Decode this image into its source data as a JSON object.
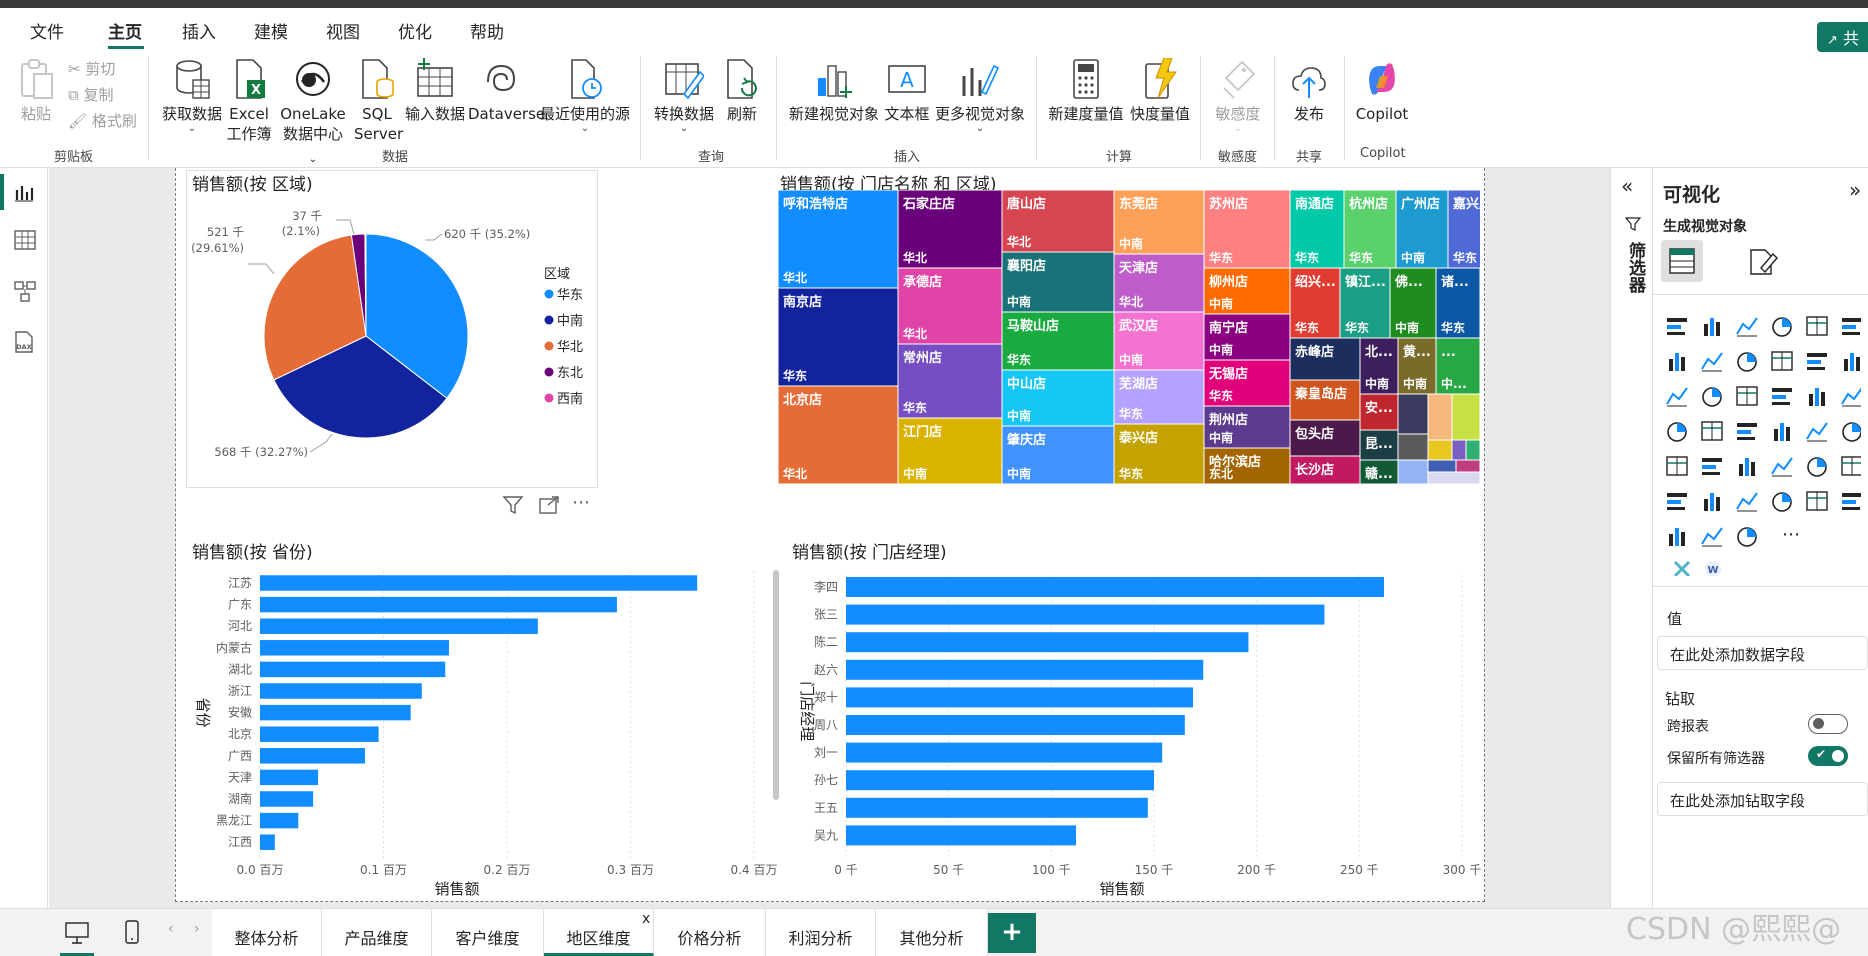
{
  "menubar": {
    "items": [
      "文件",
      "主页",
      "插入",
      "建模",
      "视图",
      "优化",
      "帮助"
    ],
    "active": "主页",
    "share_label": "共"
  },
  "ribbon": {
    "clipboard": {
      "paste": "粘贴",
      "cut": "剪切",
      "copy": "复制",
      "format_painter": "格式刷",
      "label": "剪贴板"
    },
    "data": {
      "get_data": "获取数据",
      "excel_l1": "Excel",
      "excel_l2": "工作簿",
      "onelake_l1": "OneLake",
      "onelake_l2": "数据中心",
      "sql_l1": "SQL",
      "sql_l2": "Server",
      "enter_data": "输入数据",
      "dataverse": "Dataverse",
      "recent": "最近使用的源",
      "label": "数据"
    },
    "query": {
      "transform": "转换数据",
      "refresh": "刷新",
      "label": "查询"
    },
    "insert": {
      "new_visual": "新建视觉对象",
      "textbox": "文本框",
      "more_visuals": "更多视觉对象",
      "label": "插入"
    },
    "calc": {
      "new_measure": "新建度量值",
      "quick_measure": "快度量值",
      "label": "计算"
    },
    "sensitivity": {
      "btn": "敏感度",
      "label": "敏感度"
    },
    "share": {
      "publish": "发布",
      "label": "共享"
    },
    "copilot": {
      "btn": "Copilot",
      "label": "Copilot"
    }
  },
  "visuals": {
    "pie": {
      "title": "销售额(按 区域)"
    },
    "treemap": {
      "title": "销售额(按 门店名称 和 区域)"
    },
    "bar_province": {
      "title": "销售额(按 省份)"
    },
    "bar_manager": {
      "title": "销售额(按 门店经理)"
    }
  },
  "chart_data": [
    {
      "type": "pie",
      "title": "销售额(按 区域)",
      "legend_title": "区域",
      "legend_position": "right",
      "slices": [
        {
          "name": "华东",
          "value": 620,
          "label": "620 千 (35.2%)",
          "color": "#118dff"
        },
        {
          "name": "中南",
          "value": 568,
          "label": "568 千 (32.27%)",
          "color": "#12239e"
        },
        {
          "name": "华北",
          "value": 521,
          "label_l1": "521 千",
          "label_l2": "(29.61%)",
          "color": "#e66c37"
        },
        {
          "name": "东北",
          "value": 37,
          "label_l1": "37 千",
          "label_l2": "(2.1%)",
          "color": "#6b007b"
        },
        {
          "name": "西南",
          "value": 3,
          "color": "#e044a7"
        }
      ]
    },
    {
      "type": "treemap",
      "title": "销售额(按 门店名称 和 区域)",
      "cells": [
        {
          "name": "呼和浩特店",
          "region": "华北",
          "color": "#118dff"
        },
        {
          "name": "南京店",
          "region": "华东",
          "color": "#12239e"
        },
        {
          "name": "北京店",
          "region": "华北",
          "color": "#e66c37"
        },
        {
          "name": "石家庄店",
          "region": "华北",
          "color": "#6b007b"
        },
        {
          "name": "承德店",
          "region": "华北",
          "color": "#e044a7"
        },
        {
          "name": "常州店",
          "region": "华东",
          "color": "#744ec2"
        },
        {
          "name": "江门店",
          "region": "中南",
          "color": "#d9b300"
        },
        {
          "name": "唐山店",
          "region": "华北",
          "color": "#d64550"
        },
        {
          "name": "襄阳店",
          "region": "中南",
          "color": "#197278"
        },
        {
          "name": "马鞍山店",
          "region": "华东",
          "color": "#1aab40"
        },
        {
          "name": "中山店",
          "region": "中南",
          "color": "#15c6f4"
        },
        {
          "name": "肇庆店",
          "region": "中南",
          "color": "#4092ff"
        },
        {
          "name": "东莞店",
          "region": "中南",
          "color": "#ffa058"
        },
        {
          "name": "天津店",
          "region": "华北",
          "color": "#be5dc9"
        },
        {
          "name": "武汉店",
          "region": "中南",
          "color": "#f472d0"
        },
        {
          "name": "芜湖店",
          "region": "华东",
          "color": "#b5a1ff"
        },
        {
          "name": "泰兴店",
          "region": "华东",
          "color": "#c4a200"
        },
        {
          "name": "苏州店",
          "region": "华东",
          "color": "#ff8080"
        },
        {
          "name": "柳州店",
          "region": "中南",
          "color": "#ff6b00"
        },
        {
          "name": "南宁店",
          "region": "中南",
          "color": "#8a0080"
        },
        {
          "name": "无锡店",
          "region": "华东",
          "color": "#e2007a"
        },
        {
          "name": "荆州店",
          "region": "中南",
          "color": "#5c3a8e"
        },
        {
          "name": "哈尔滨店",
          "region": "东北",
          "color": "#a36500"
        },
        {
          "name": "南通店",
          "region": "华东",
          "color": "#00c9a7"
        },
        {
          "name": "杭州店",
          "region": "华东",
          "color": "#5ad16d"
        },
        {
          "name": "广州店",
          "region": "中南",
          "color": "#1d9bd1"
        },
        {
          "name": "嘉兴店",
          "region": "华东",
          "color": "#4f6ad6"
        },
        {
          "name": "绍兴...",
          "region": "华东",
          "color": "#e03c31"
        },
        {
          "name": "镇江...",
          "region": "华东",
          "color": "#1a9f84"
        },
        {
          "name": "佛...",
          "region": "中南",
          "color": "#1e8c1e"
        },
        {
          "name": "诸...",
          "region": "华东",
          "color": "#0b57a4"
        },
        {
          "name": "赤峰店",
          "region": "",
          "color": "#1c2e5e"
        },
        {
          "name": "北...",
          "region": "中南",
          "color": "#3e1f5e"
        },
        {
          "name": "黄...",
          "region": "中南",
          "color": "#7b6b2b"
        },
        {
          "name": "...",
          "region": "中...",
          "color": "#28a745"
        },
        {
          "name": "秦皇岛店",
          "region": "",
          "color": "#d0541e"
        },
        {
          "name": "安...",
          "region": "",
          "color": "#c0262d"
        },
        {
          "name": "包头店",
          "region": "",
          "color": "#4b1a4b"
        },
        {
          "name": "昆...",
          "region": "",
          "color": "#1b3e44"
        },
        {
          "name": "长沙店",
          "region": "",
          "color": "#c21a62"
        },
        {
          "name": "赣...",
          "region": "",
          "color": "#125a36"
        }
      ]
    },
    {
      "type": "bar",
      "orientation": "horizontal",
      "title": "销售额(按 省份)",
      "categories": [
        "江苏",
        "广东",
        "河北",
        "内蒙古",
        "湖北",
        "浙江",
        "安徽",
        "北京",
        "广西",
        "天津",
        "湖南",
        "黑龙江",
        "江西"
      ],
      "values": [
        0.354,
        0.289,
        0.225,
        0.153,
        0.15,
        0.131,
        0.122,
        0.096,
        0.085,
        0.047,
        0.043,
        0.031,
        0.012
      ],
      "xlabel": "销售额",
      "ylabel": "省份",
      "xlim": [
        0,
        0.4
      ],
      "ticks": [
        "0.0 百万",
        "0.1 百万",
        "0.2 百万",
        "0.3 百万",
        "0.4 百万"
      ],
      "color": "#118dff"
    },
    {
      "type": "bar",
      "orientation": "horizontal",
      "title": "销售额(按 门店经理)",
      "categories": [
        "李四",
        "张三",
        "陈二",
        "赵六",
        "郑十",
        "周八",
        "刘一",
        "孙七",
        "王五",
        "吴九"
      ],
      "values": [
        262,
        233,
        196,
        174,
        169,
        165,
        154,
        150,
        147,
        112
      ],
      "xlabel": "销售额",
      "ylabel": "门店经理",
      "xlim": [
        0,
        300
      ],
      "ticks": [
        "0 千",
        "50 千",
        "100 千",
        "150 千",
        "200 千",
        "250 千",
        "300 千"
      ],
      "color": "#118dff"
    }
  ],
  "filter_pane": {
    "label": "筛选器"
  },
  "viz_pane": {
    "title": "可视化",
    "build_visual": "生成视觉对象",
    "values_label": "值",
    "values_placeholder": "在此处添加数据字段",
    "drill_label": "钻取",
    "cross_report": "跨报表",
    "keep_filters": "保留所有筛选器",
    "drill_placeholder": "在此处添加钻取字段"
  },
  "tabs": [
    {
      "label": "整体分析"
    },
    {
      "label": "产品维度"
    },
    {
      "label": "客户维度"
    },
    {
      "label": "地区维度",
      "active": true
    },
    {
      "label": "价格分析"
    },
    {
      "label": "利润分析"
    },
    {
      "label": "其他分析"
    }
  ],
  "tab_close": "x",
  "add_tab": "+",
  "watermark": "CSDN @熙熙@"
}
